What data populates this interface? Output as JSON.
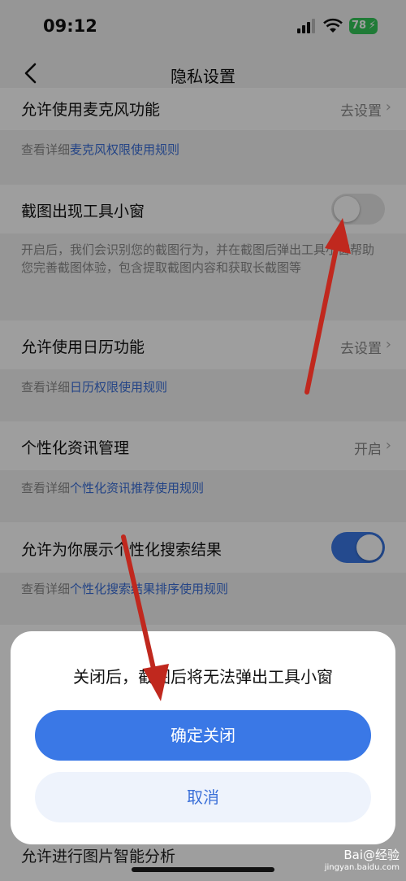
{
  "status_bar": {
    "time": "09:12",
    "battery": "78"
  },
  "nav": {
    "title": "隐私设置"
  },
  "rows": [
    {
      "label": "允许使用麦克风功能",
      "action": "去设置",
      "desc_prefix": "查看详细",
      "desc_link": "麦克风权限使用规则"
    },
    {
      "label": "截图出现工具小窗",
      "toggle": "off",
      "desc": "开启后，我们会识别您的截图行为，并在截图后弹出工具小窗帮助您完善截图体验，包含提取截图内容和获取长截图等"
    },
    {
      "label": "允许使用日历功能",
      "action": "去设置",
      "desc_prefix": "查看详细",
      "desc_link": "日历权限使用规则"
    },
    {
      "label": "个性化资讯管理",
      "action": "开启",
      "desc_prefix": "查看详细",
      "desc_link": "个性化资讯推荐使用规则"
    },
    {
      "label": "允许为你展示个性化搜索结果",
      "toggle": "on",
      "desc_prefix": "查看详细",
      "desc_link": "个性化搜索结果排序使用规则"
    }
  ],
  "dialog": {
    "message": "关闭后，截图后将无法弹出工具小窗",
    "confirm_label": "确定关闭",
    "cancel_label": "取消"
  },
  "behind_row_label": "允许进行图片智能分析",
  "watermark": {
    "brand": "Bai@经验",
    "domain": "jingyan.baidu.com"
  },
  "colors": {
    "accent": "#3a78e6",
    "annotation_arrow": "#c0281e"
  }
}
